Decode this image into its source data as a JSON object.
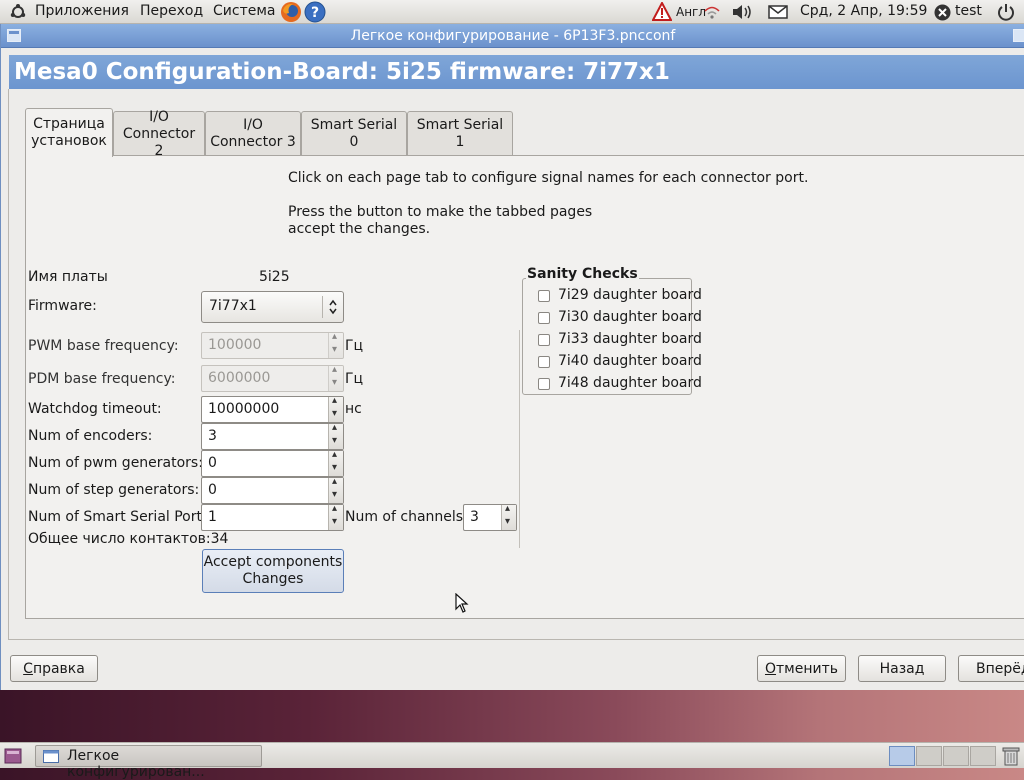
{
  "top_panel": {
    "menu": [
      "Приложения",
      "Переход",
      "Система"
    ],
    "keyboard_layout": "Англ",
    "datetime": "Срд,  2 Апр, 19:59",
    "user": "test"
  },
  "window": {
    "title": "Легкое конфигурирование - 6P13F3.pncconf",
    "header": "Mesa0 Configuration-Board: 5i25 firmware: 7i77x1"
  },
  "tabs": [
    {
      "label": "Страница установок"
    },
    {
      "label": "I/O Connector 2"
    },
    {
      "label": "I/O Connector 3"
    },
    {
      "label": "Smart Serial 0"
    },
    {
      "label": "Smart Serial 1"
    }
  ],
  "info": {
    "line1": "Click on each page tab to configure signal names for each connector port.",
    "line2": "Press the button to make the tabbed pages",
    "line3": "accept the changes."
  },
  "form": {
    "board_label": "Имя платы",
    "board_value": "5i25",
    "firmware_label": "Firmware:",
    "firmware_value": "7i77x1",
    "pwm_label": "PWM base frequency:",
    "pwm_value": "100000",
    "pwm_unit": "Гц",
    "pdm_label": "PDM base frequency:",
    "pdm_value": "6000000",
    "pdm_unit": "Гц",
    "watchdog_label": "Watchdog timeout:",
    "watchdog_value": "10000000",
    "watchdog_unit": "нс",
    "encoders_label": "Num of encoders:",
    "encoders_value": "3",
    "pwmgen_label": "Num of pwm generators:",
    "pwmgen_value": "0",
    "stepgen_label": "Num of step generators:",
    "stepgen_value": "0",
    "sserial_label": "Num of Smart Serial Ports:",
    "sserial_value": "1",
    "channels_label": "Num of channels:",
    "channels_value": "3",
    "total_pins_label": "Общее число контактов:",
    "total_pins_value": "34",
    "accept_line1": "Accept  components",
    "accept_line2": "Changes"
  },
  "sanity": {
    "title": "Sanity Checks",
    "items": [
      "7i29 daughter board",
      "7i30 daughter board",
      "7i33 daughter board",
      "7i40 daughter board",
      "7i48 daughter board"
    ]
  },
  "bottom_buttons": {
    "help_prefix": "С",
    "help_rest": "правка",
    "cancel_prefix": "О",
    "cancel_rest": "тменить",
    "back": "Назад",
    "forward": "Вперёд"
  },
  "taskbar": {
    "task_label": "Легкое конфигурирован..."
  }
}
